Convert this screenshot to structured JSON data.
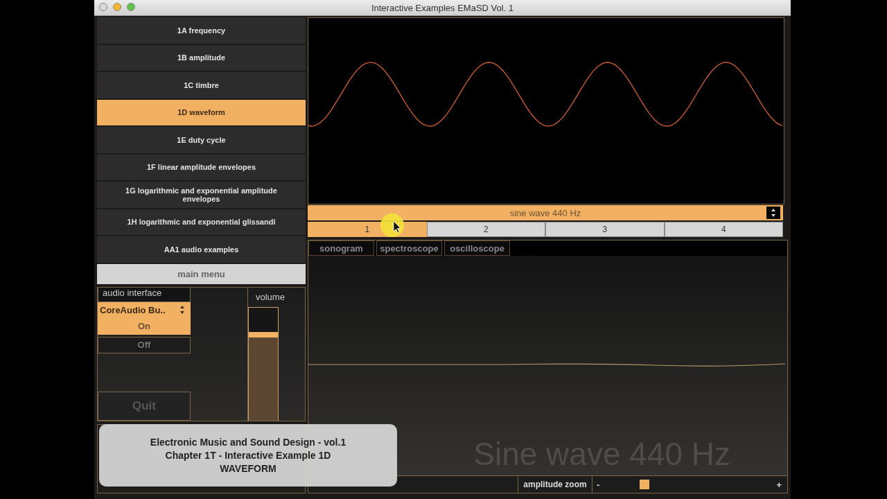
{
  "window": {
    "title": "Interactive Examples EMaSD Vol. 1"
  },
  "menu": [
    {
      "label": "1A frequency",
      "selected": false
    },
    {
      "label": "1B amplitude",
      "selected": false
    },
    {
      "label": "1C timbre",
      "selected": false
    },
    {
      "label": "1D waveform",
      "selected": true
    },
    {
      "label": "1E duty cycle",
      "selected": false
    },
    {
      "label": "1F linear amplitude envelopes",
      "selected": false
    },
    {
      "label": "1G logarithmic and exponential amplitude envelopes",
      "selected": false
    },
    {
      "label": "1H logarithmic and exponential glissandi",
      "selected": false
    },
    {
      "label": "AA1 audio examples",
      "selected": false
    }
  ],
  "main_menu": "main menu",
  "audio_interface": {
    "label": "audio interface",
    "device": "CoreAudio Bu..",
    "power": [
      {
        "label": "On",
        "selected": true
      },
      {
        "label": "Off",
        "selected": false
      }
    ]
  },
  "quit": "Quit",
  "volume": {
    "label": "volume",
    "level": 0.78
  },
  "caption": [
    "Electronic Music and Sound Design - vol.1",
    "Chapter 1T - Interactive Example 1D",
    "WAVEFORM"
  ],
  "preset": {
    "value": "sine wave 440 Hz"
  },
  "presets": [
    {
      "label": "1",
      "selected": true
    },
    {
      "label": "2",
      "selected": false
    },
    {
      "label": "3",
      "selected": false
    },
    {
      "label": "4",
      "selected": false
    }
  ],
  "scope_tabs": [
    {
      "label": "sonogram",
      "selected": false
    },
    {
      "label": "spectroscope",
      "selected": false
    },
    {
      "label": "oscilloscope",
      "selected": false
    }
  ],
  "scope_title": "Sine wave 440 Hz",
  "amplitude_zoom": {
    "label": "amplitude zoom",
    "minus": "-",
    "plus": "+",
    "level": 0.24
  }
}
